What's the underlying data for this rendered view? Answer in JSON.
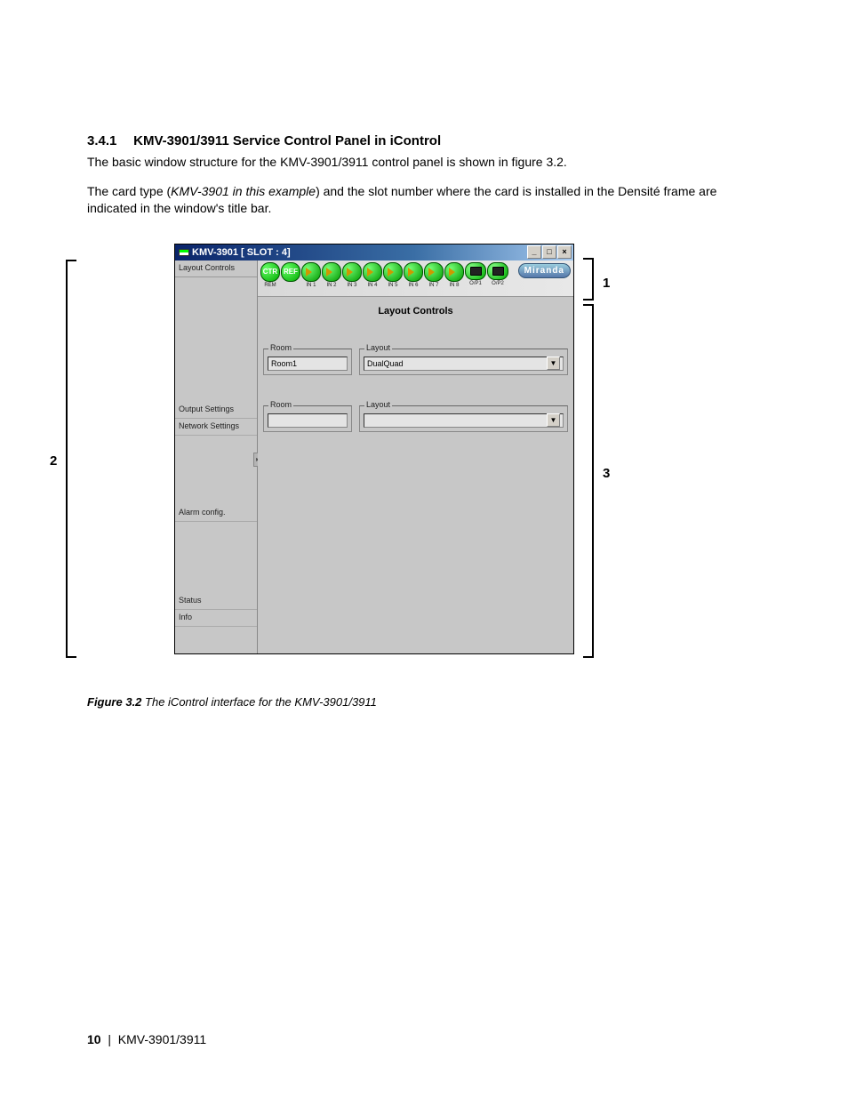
{
  "doc": {
    "section_number": "3.4.1",
    "section_title": "KMV-3901/3911 Service Control Panel in iControl",
    "para1": "The basic window structure for the KMV-3901/3911 control panel is shown in figure 3.2.",
    "para2_a": "The card type (",
    "para2_italic": "KMV-3901 in this example",
    "para2_b": ") and the slot number where the card is installed in the Densité frame are indicated in the window's title bar.",
    "fig_label": "Figure 3.2",
    "fig_text": "  The iControl interface for the KMV-3901/3911",
    "page_num": "10",
    "page_model": "KMV-3901/3911"
  },
  "callouts": {
    "c1": "1",
    "c2": "2",
    "c3": "3"
  },
  "app": {
    "title": "KMV-3901 [ SLOT : 4]",
    "brand": "Miranda",
    "sidebar": {
      "layout_controls": "Layout Controls",
      "output_settings": "Output Settings",
      "network_settings": "Network Settings",
      "alarm_config": "Alarm config.",
      "status": "Status",
      "info": "Info"
    },
    "icons": {
      "rem": "REM",
      "ctr": "CTR",
      "ref": "REF",
      "in1": "IN 1",
      "in2": "IN 2",
      "in3": "IN 3",
      "in4": "IN 4",
      "in5": "IN 5",
      "in6": "IN 6",
      "in7": "IN 7",
      "in8": "IN 8",
      "op1": "O/P1",
      "op2": "O/P2"
    },
    "panel": {
      "title": "Layout Controls",
      "room_label": "Room",
      "layout_label": "Layout",
      "room1_value": "Room1",
      "layout1_value": "DualQuad",
      "room2_value": "",
      "layout2_value": ""
    }
  }
}
